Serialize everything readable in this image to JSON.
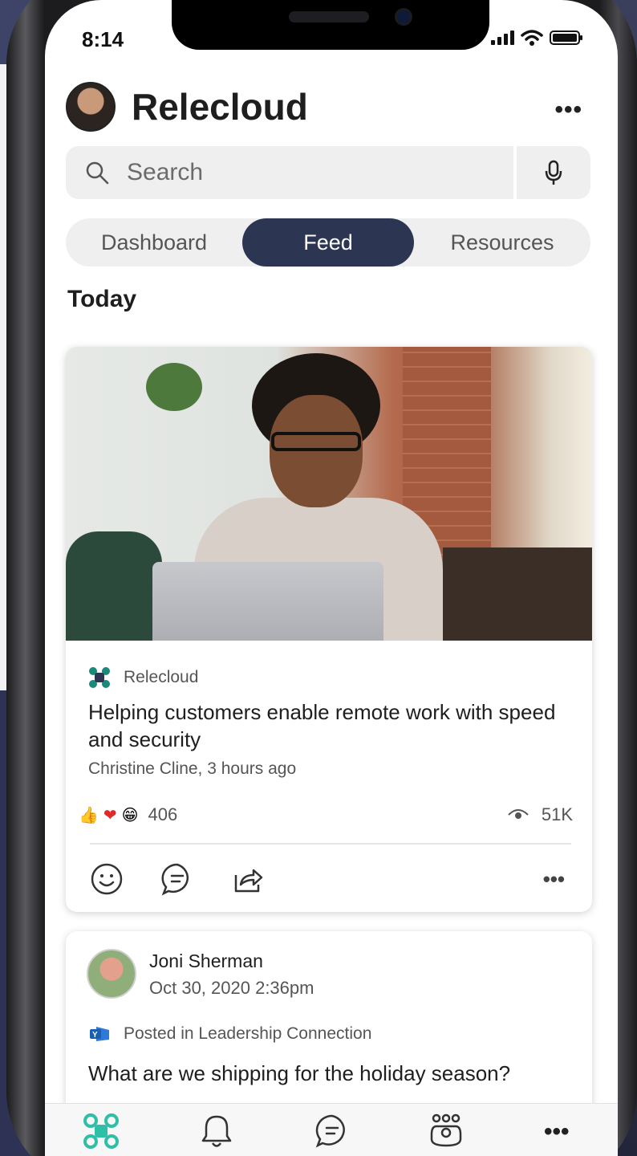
{
  "status_bar": {
    "time": "8:14"
  },
  "header": {
    "title": "Relecloud",
    "more": "•••"
  },
  "search": {
    "placeholder": "Search"
  },
  "tabs": [
    {
      "label": "Dashboard",
      "selected": false
    },
    {
      "label": "Feed",
      "selected": true
    },
    {
      "label": "Resources",
      "selected": false
    }
  ],
  "section_heading": "Today",
  "feed": [
    {
      "source": "Relecloud",
      "title": "Helping customers enable remote work with speed and security",
      "byline": "Christine Cline, 3 hours ago",
      "reaction_count": "406",
      "view_count": "51K",
      "more": "•••"
    },
    {
      "author": "Joni Sherman",
      "date": "Oct 30, 2020 2:36pm",
      "posted_in": "Posted in Leadership Connection",
      "text": "What are we shipping for the holiday season?"
    }
  ],
  "bottom_nav": {
    "more": "•••"
  },
  "colors": {
    "tab_selected": "#2c3652",
    "accent": "#2fbfa6"
  }
}
